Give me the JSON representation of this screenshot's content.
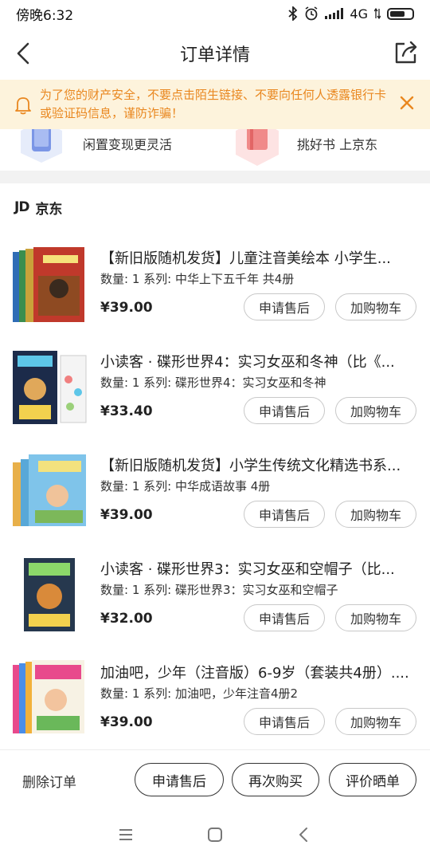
{
  "status_bar": {
    "time": "傍晚6:32",
    "network": "4G"
  },
  "header": {
    "title": "订单详情"
  },
  "warning": {
    "text": "为了您的财产安全，不要点击陌生链接、不要向任何人透露银行卡或验证码信息，谨防诈骗！"
  },
  "promo": {
    "left_text": "闲置变现更灵活",
    "right_text": "挑好书 上京东"
  },
  "shop": {
    "logo": "JD",
    "name": "京东"
  },
  "items": [
    {
      "name": "【新旧版随机发货】儿童注音美绘本 小学生...",
      "meta": "数量: 1 系列: 中华上下五千年 共4册",
      "price": "¥39.00",
      "after_sale": "申请售后",
      "add_cart": "加购物车"
    },
    {
      "name": "小读客 · 碟形世界4：实习女巫和冬神（比《...",
      "meta": "数量: 1 系列: 碟形世界4：实习女巫和冬神",
      "price": "¥33.40",
      "after_sale": "申请售后",
      "add_cart": "加购物车"
    },
    {
      "name": "【新旧版随机发货】小学生传统文化精选书系...",
      "meta": "数量: 1 系列: 中华成语故事 4册",
      "price": "¥39.00",
      "after_sale": "申请售后",
      "add_cart": "加购物车"
    },
    {
      "name": "小读客 · 碟形世界3：实习女巫和空帽子（比...",
      "meta": "数量: 1 系列: 碟形世界3：实习女巫和空帽子",
      "price": "¥32.00",
      "after_sale": "申请售后",
      "add_cart": "加购物车"
    },
    {
      "name": "加油吧，少年（注音版）6-9岁（套装共4册）....",
      "meta": "数量: 1 系列: 加油吧，少年注音4册2",
      "price": "¥39.00",
      "after_sale": "申请售后",
      "add_cart": "加购物车"
    }
  ],
  "bottom_bar": {
    "delete": "删除订单",
    "after_sale": "申请售后",
    "rebuy": "再次购买",
    "review": "评价晒单"
  },
  "colors": {
    "warning_bg": "#fdf3dc",
    "warning_text": "#e9871f",
    "text": "#222222"
  }
}
